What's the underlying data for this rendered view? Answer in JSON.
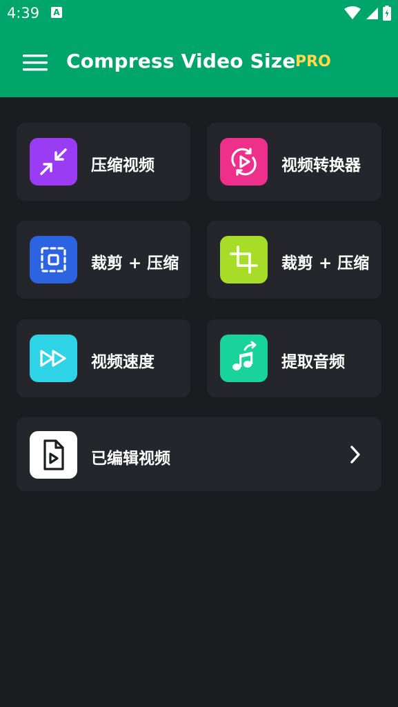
{
  "status_bar": {
    "time": "4:39",
    "notif_icon": "a-icon"
  },
  "app_bar": {
    "title": "Compress Video Size",
    "badge": "PRO",
    "bg_color": "#00a56c",
    "badge_color": "#ffd84a"
  },
  "menu": {
    "compress": {
      "label": "压缩视频",
      "icon": "compress-arrows-icon",
      "color": "#9b3cf5"
    },
    "converter": {
      "label": "视频转换器",
      "icon": "convert-play-icon",
      "color": "#ef2f8c"
    },
    "crop_compress_1": {
      "label": "裁剪 + 压缩",
      "icon": "select-crop-icon",
      "color": "#2b63e0"
    },
    "crop_compress_2": {
      "label": "裁剪 + 压缩",
      "icon": "crop-icon",
      "color": "#a7dd26"
    },
    "speed": {
      "label": "视频速度",
      "icon": "fast-forward-icon",
      "color": "#2fd3e6"
    },
    "extract_audio": {
      "label": "提取音频",
      "icon": "music-extract-icon",
      "color": "#19d49a"
    },
    "edited": {
      "label": "已编辑视频",
      "icon": "video-file-icon",
      "color": "#ffffff"
    }
  }
}
